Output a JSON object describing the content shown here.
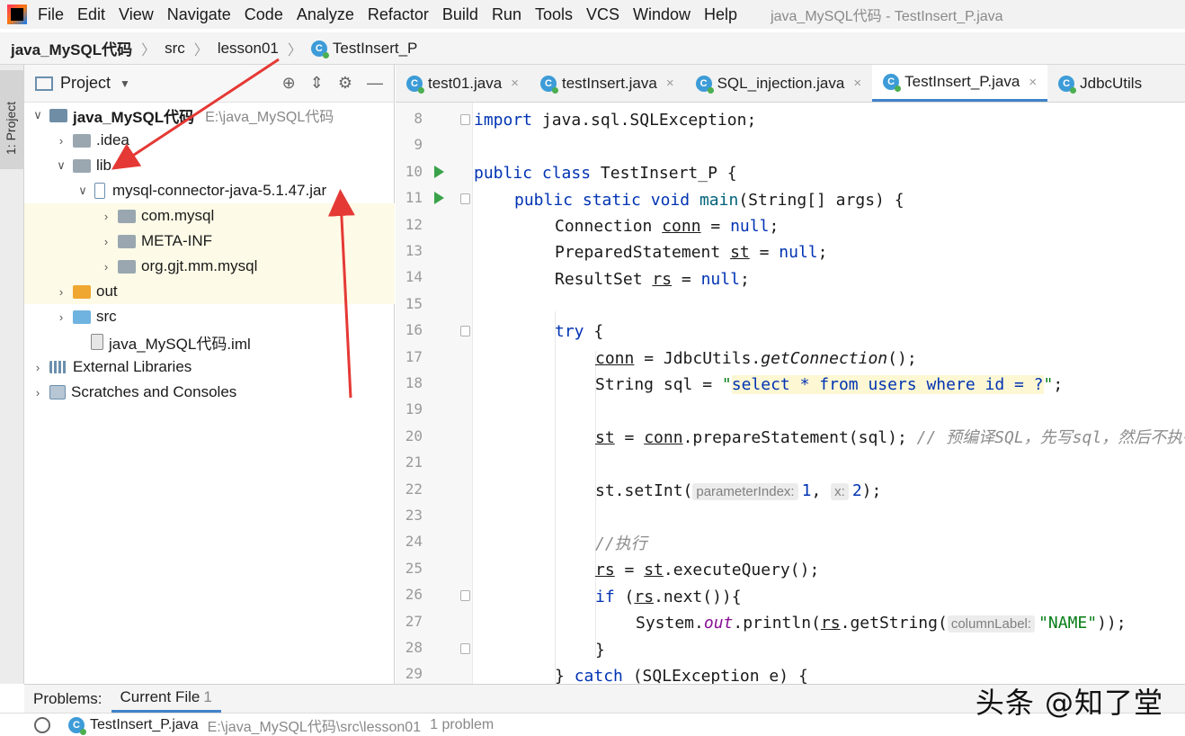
{
  "menubar": {
    "items": [
      "File",
      "Edit",
      "View",
      "Navigate",
      "Code",
      "Analyze",
      "Refactor",
      "Build",
      "Run",
      "Tools",
      "VCS",
      "Window",
      "Help"
    ],
    "title": "java_MySQL代码 - TestInsert_P.java"
  },
  "breadcrumb": {
    "project": "java_MySQL代码",
    "src": "src",
    "package": "lesson01",
    "class": "TestInsert_P"
  },
  "tool_stripe": {
    "project_tab": "1: Project"
  },
  "project_panel": {
    "title": "Project",
    "tree": [
      {
        "label": "java_MySQL代码",
        "path": "E:\\java_MySQL代码",
        "bold": true
      },
      {
        "label": ".idea"
      },
      {
        "label": "lib"
      },
      {
        "label": "mysql-connector-java-5.1.47.jar"
      },
      {
        "label": "com.mysql"
      },
      {
        "label": "META-INF"
      },
      {
        "label": "org.gjt.mm.mysql"
      },
      {
        "label": "out"
      },
      {
        "label": "src"
      },
      {
        "label": "java_MySQL代码.iml"
      },
      {
        "label": "External Libraries"
      },
      {
        "label": "Scratches and Consoles"
      }
    ]
  },
  "editor": {
    "tabs": [
      "test01.java",
      "testInsert.java",
      "SQL_injection.java",
      "TestInsert_P.java",
      "JdbcUtils"
    ],
    "line_numbers": [
      "8",
      "9",
      "10",
      "11",
      "12",
      "13",
      "14",
      "15",
      "16",
      "17",
      "18",
      "19",
      "20",
      "21",
      "22",
      "23",
      "24",
      "25",
      "26",
      "27",
      "28",
      "29"
    ],
    "code": {
      "l8_kw": "import",
      "l8_rest": " java.sql.SQLException;",
      "l10_kw1": "public",
      "l10_kw2": "class",
      "l10_rest": " TestInsert_P {",
      "l11_kw1": "public",
      "l11_kw2": "static",
      "l11_kw3": "void",
      "l11_fn": "main",
      "l11_rest": "(String[] args) {",
      "l12_a": "Connection ",
      "l12_var": "conn",
      "l12_b": " = ",
      "l12_kw": "null",
      "l12_c": ";",
      "l13_a": "PreparedStatement ",
      "l13_var": "st",
      "l13_b": " = ",
      "l13_kw": "null",
      "l13_c": ";",
      "l14_a": "ResultSet ",
      "l14_var": "rs",
      "l14_b": " = ",
      "l14_kw": "null",
      "l14_c": ";",
      "l16_kw": "try",
      "l16_rest": " {",
      "l17_var": "conn",
      "l17_a": " = JdbcUtils.",
      "l17_fn": "getConnection",
      "l17_b": "();",
      "l18_a": "String sql = ",
      "l18_q1": "\"",
      "l18_sql": "select * from users where id = ?",
      "l18_q2": "\"",
      "l18_b": ";",
      "l20_var1": "st",
      "l20_a": " = ",
      "l20_var2": "conn",
      "l20_b": ".prepareStatement(sql); ",
      "l20_cmt": "// 预编译SQL，先写sql，然后不执行",
      "l22_a": "st.setInt(",
      "l22_hint1": "parameterIndex:",
      "l22_num1": "1",
      "l22_b": ", ",
      "l22_hint2": "x:",
      "l22_num2": "2",
      "l22_c": ");",
      "l24_cmt": "//执行",
      "l25_var1": "rs",
      "l25_a": " = ",
      "l25_var2": "st",
      "l25_b": ".executeQuery();",
      "l26_kw": "if",
      "l26_a": " (",
      "l26_var": "rs",
      "l26_b": ".next()){",
      "l27_a": "System.",
      "l27_field": "out",
      "l27_b": ".println(",
      "l27_var": "rs",
      "l27_c": ".getString(",
      "l27_hint": "columnLabel:",
      "l27_str": "\"NAME\"",
      "l27_d": "));",
      "l28": "}",
      "l29_a": "} ",
      "l29_kw": "catch",
      "l29_b": " (SQLException e) {"
    }
  },
  "problems": {
    "tabs": [
      {
        "label": "Problems:",
        "count": ""
      },
      {
        "label": "Current File",
        "count": "1"
      }
    ],
    "file": "TestInsert_P.java",
    "path": "E:\\java_MySQL代码\\src\\lesson01",
    "count": "1 problem"
  },
  "watermark": "头条 @知了堂",
  "colors": {
    "keyword": "#0033b3",
    "string": "#067d17",
    "comment": "#8c8c8c",
    "arrow": "#e53935",
    "active_tab": "#4083c9"
  }
}
